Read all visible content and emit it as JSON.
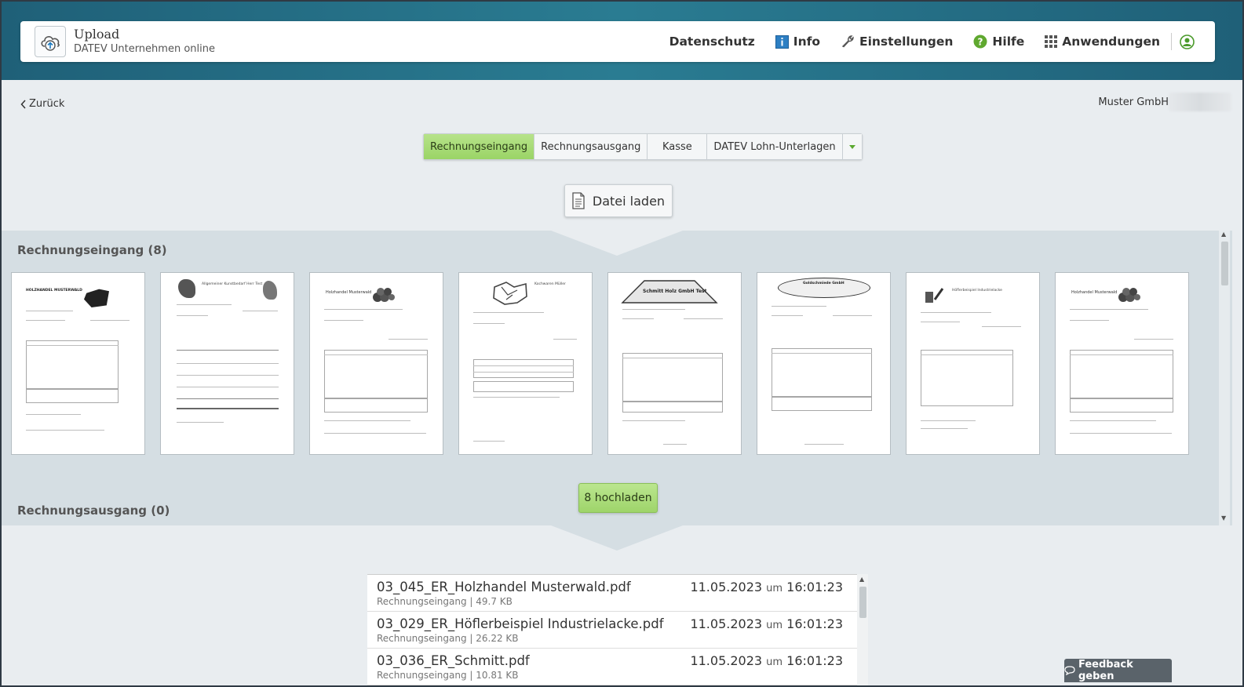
{
  "header": {
    "app_title": "Upload",
    "app_subtitle": "DATEV Unternehmen online",
    "nav": {
      "datenschutz": "Datenschutz",
      "info": "Info",
      "einstellungen": "Einstellungen",
      "hilfe": "Hilfe",
      "anwendungen": "Anwendungen"
    }
  },
  "back_label": "Zurück",
  "company_name": "Muster GmbH",
  "segments": {
    "rechnungseingang": "Rechnungseingang",
    "rechnungsausgang": "Rechnungsausgang",
    "kasse": "Kasse",
    "lohn": "DATEV Lohn-Unterlagen"
  },
  "load_button": "Datei laden",
  "panel": {
    "title_in": "Rechnungseingang (8)",
    "title_out": "Rechnungsausgang (0)",
    "upload_button": "8 hochladen"
  },
  "files": [
    {
      "name": "03_045_ER_Holzhandel Musterwald.pdf",
      "meta": "Rechnungseingang  |  49.7 KB",
      "date": "11.05.2023",
      "um": "um",
      "time": "16:01:23"
    },
    {
      "name": "03_029_ER_Höflerbeispiel Industrielacke.pdf",
      "meta": "Rechnungseingang  |  26.22 KB",
      "date": "11.05.2023",
      "um": "um",
      "time": "16:01:23"
    },
    {
      "name": "03_036_ER_Schmitt.pdf",
      "meta": "Rechnungseingang  |  10.81 KB",
      "date": "11.05.2023",
      "um": "um",
      "time": "16:01:23"
    }
  ],
  "feedback_label": "Feedback geben",
  "thumb_texts": {
    "t1": "HOLZHANDEL MUSTERWALD",
    "t2": "Allgemeiner Kunstbedarf Herr Test",
    "t3": "Holzhandel Musterwald",
    "t4": "Kochwaren Müller",
    "t5": "Schmitt Holz GmbH Test",
    "t6": "Goldschmiede GmbH",
    "t7": "Höflerbeispiel Industrielacke",
    "t8": "Holzhandel Musterwald"
  },
  "colors": {
    "accent_green": "#9ad466",
    "band": "#1f6078",
    "panel": "#d5dee3"
  }
}
